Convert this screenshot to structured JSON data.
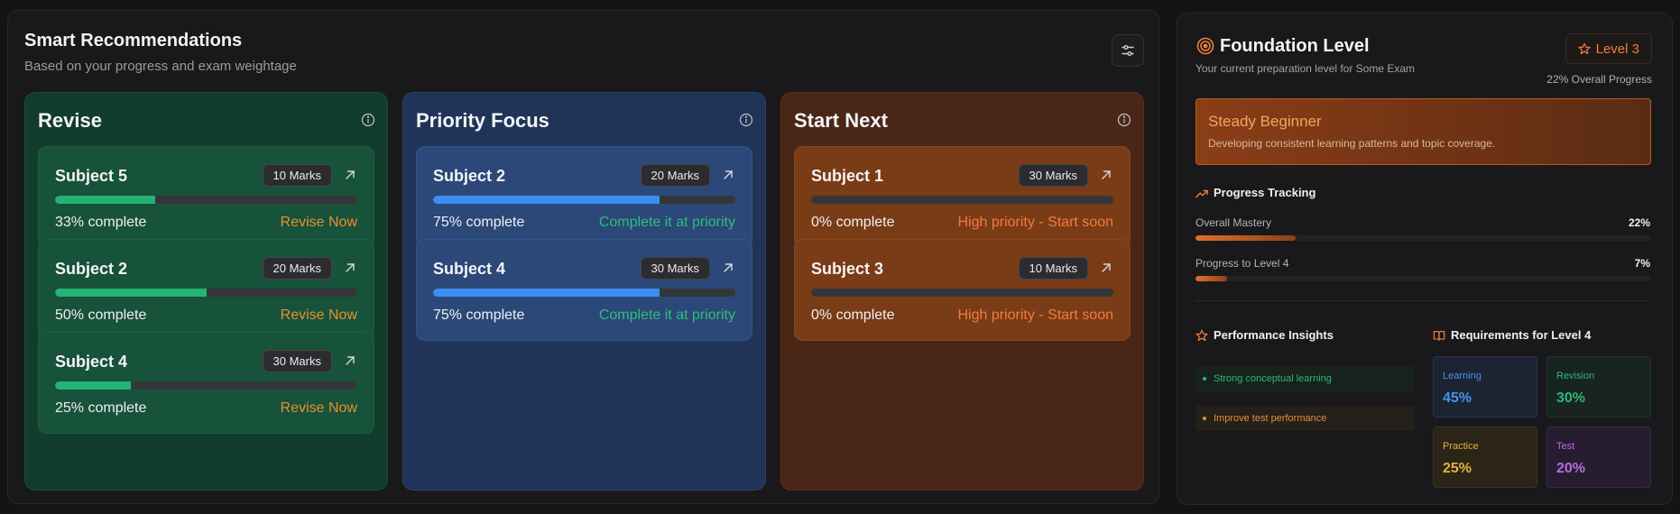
{
  "recommendations": {
    "title": "Smart Recommendations",
    "subtitle": "Based on your progress and exam weightage",
    "columns": [
      {
        "title": "Revise",
        "cards": [
          {
            "name": "Subject 5",
            "marks": "10 Marks",
            "progress": 33,
            "progress_text": "33% complete",
            "action": "Revise Now"
          },
          {
            "name": "Subject 2",
            "marks": "20 Marks",
            "progress": 50,
            "progress_text": "50% complete",
            "action": "Revise Now"
          },
          {
            "name": "Subject 4",
            "marks": "30 Marks",
            "progress": 25,
            "progress_text": "25% complete",
            "action": "Revise Now"
          }
        ]
      },
      {
        "title": "Priority Focus",
        "cards": [
          {
            "name": "Subject 2",
            "marks": "20 Marks",
            "progress": 75,
            "progress_text": "75% complete",
            "action": "Complete it at priority"
          },
          {
            "name": "Subject 4",
            "marks": "30 Marks",
            "progress": 75,
            "progress_text": "75% complete",
            "action": "Complete it at priority"
          }
        ]
      },
      {
        "title": "Start Next",
        "cards": [
          {
            "name": "Subject 1",
            "marks": "30 Marks",
            "progress": 0,
            "progress_text": "0% complete",
            "action": "High priority - Start soon"
          },
          {
            "name": "Subject 3",
            "marks": "10 Marks",
            "progress": 0,
            "progress_text": "0% complete",
            "action": "High priority - Start soon"
          }
        ]
      }
    ]
  },
  "foundation": {
    "title": "Foundation Level",
    "subtitle": "Your current preparation level for Some Exam",
    "level_label": "Level 3",
    "overall_progress": "22% Overall Progress",
    "stage": {
      "title": "Steady Beginner",
      "description": "Developing consistent learning patterns and topic coverage."
    },
    "progress_tracking": {
      "title": "Progress Tracking",
      "items": [
        {
          "label": "Overall Mastery",
          "value_text": "22%",
          "value": 22
        },
        {
          "label": "Progress to Level 4",
          "value_text": "7%",
          "value": 7
        }
      ]
    },
    "insights": {
      "title": "Performance Insights",
      "items": [
        "Strong conceptual learning",
        "Improve test performance"
      ]
    },
    "requirements": {
      "title": "Requirements for Level 4",
      "items": [
        {
          "label": "Learning",
          "value": "45%"
        },
        {
          "label": "Revision",
          "value": "30%"
        },
        {
          "label": "Practice",
          "value": "25%"
        },
        {
          "label": "Test",
          "value": "20%"
        }
      ]
    }
  },
  "colors": {
    "revise_accent": "#24b374",
    "priority_accent": "#3d8ef0",
    "start_accent": "#e07a2e",
    "brand_orange": "#f07c3c"
  },
  "icons": [
    "filter-settings-icon",
    "info-icon",
    "arrow-up-right-icon",
    "target-icon",
    "star-icon",
    "trending-up-icon",
    "book-icon"
  ]
}
